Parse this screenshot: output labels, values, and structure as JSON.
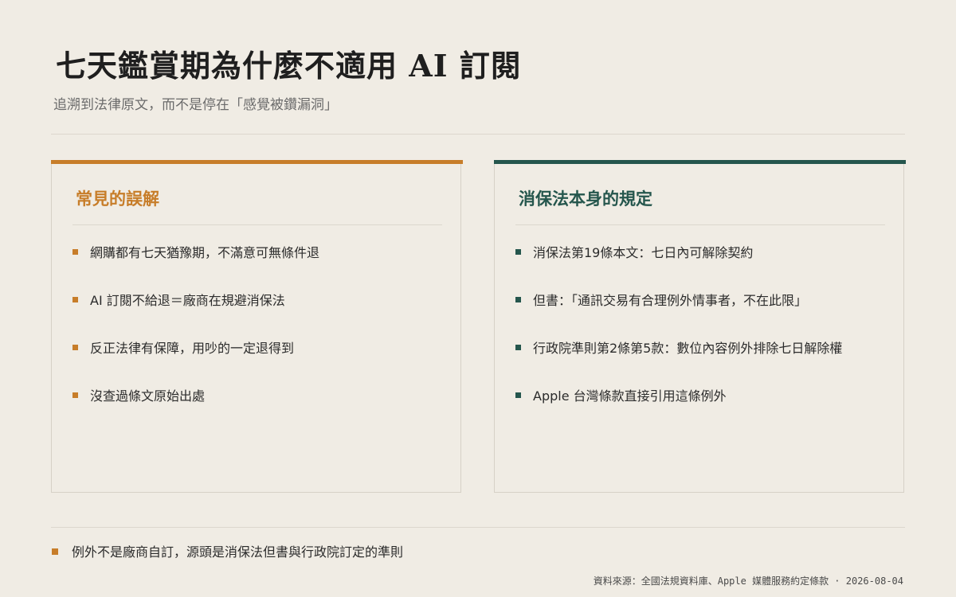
{
  "title": "七天鑑賞期為什麼不適用 AI 訂閱",
  "subtitle": "追溯到法律原文，而不是停在「感覺被鑽漏洞」",
  "colors": {
    "background": "#f0ece4",
    "accent_orange": "#c77d29",
    "accent_green": "#25564d"
  },
  "left_card": {
    "title": "常見的誤解",
    "items": [
      "網購都有七天猶豫期，不滿意可無條件退",
      "AI 訂閱不給退＝廠商在規避消保法",
      "反正法律有保障，用吵的一定退得到",
      "沒查過條文原始出處"
    ]
  },
  "right_card": {
    "title": "消保法本身的規定",
    "items": [
      "消保法第19條本文：七日內可解除契約",
      "但書：「通訊交易有合理例外情事者，不在此限」",
      "行政院準則第2條第5款：數位內容例外排除七日解除權",
      "Apple 台灣條款直接引用這條例外"
    ]
  },
  "footer": {
    "note": "例外不是廠商自訂，源頭是消保法但書與行政院訂定的準則",
    "source": "資料來源：全國法規資料庫、Apple 媒體服務約定條款 · 2026-08-04"
  }
}
